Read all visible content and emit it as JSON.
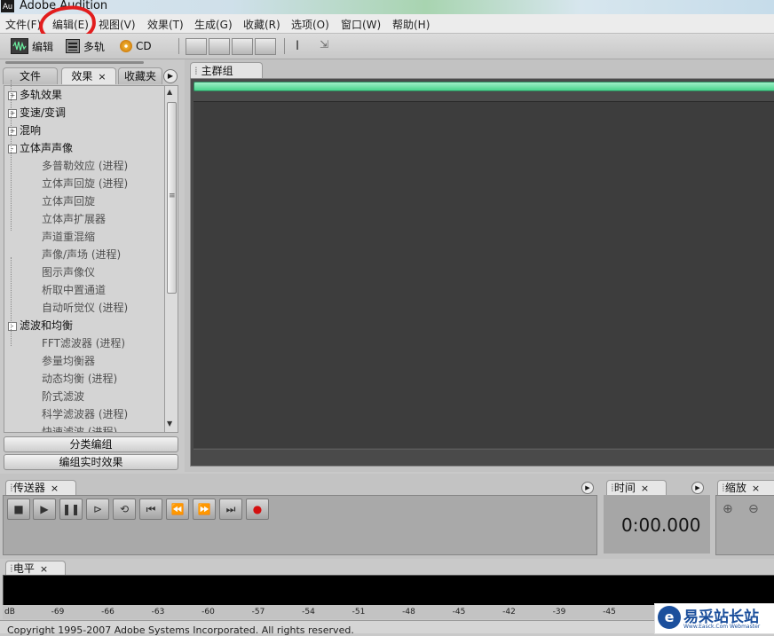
{
  "window": {
    "title": "Adobe Audition",
    "icon_label": "Au"
  },
  "menu": [
    "文件(F)",
    "编辑(E)",
    "视图(V)",
    "效果(T)",
    "生成(G)",
    "收藏(R)",
    "选项(O)",
    "窗口(W)",
    "帮助(H)"
  ],
  "toolbar": {
    "edit_label": "编辑",
    "multitrack_label": "多轨",
    "cd_label": "CD"
  },
  "left_panel": {
    "tabs": [
      "文件",
      "效果",
      "收藏夹"
    ],
    "tree": [
      {
        "label": "多轨效果",
        "level": 0,
        "expander": "+"
      },
      {
        "label": "变速/变调",
        "level": 0,
        "expander": "+"
      },
      {
        "label": "混响",
        "level": 0,
        "expander": "+"
      },
      {
        "label": "立体声声像",
        "level": 0,
        "expander": "-"
      },
      {
        "label": "多普勒效应 (进程)",
        "level": 1
      },
      {
        "label": "立体声回旋 (进程)",
        "level": 1
      },
      {
        "label": "立体声回旋",
        "level": 1
      },
      {
        "label": "立体声扩展器",
        "level": 1
      },
      {
        "label": "声道重混缩",
        "level": 1
      },
      {
        "label": "声像/声场 (进程)",
        "level": 1
      },
      {
        "label": "图示声像仪",
        "level": 1
      },
      {
        "label": "析取中置通道",
        "level": 1
      },
      {
        "label": "自动听觉仪 (进程)",
        "level": 1
      },
      {
        "label": "滤波和均衡",
        "level": 0,
        "expander": "-"
      },
      {
        "label": "FFT滤波器 (进程)",
        "level": 1
      },
      {
        "label": "参量均衡器",
        "level": 1
      },
      {
        "label": "动态均衡 (进程)",
        "level": 1
      },
      {
        "label": "阶式滤波",
        "level": 1
      },
      {
        "label": "科学滤波器 (进程)",
        "level": 1
      },
      {
        "label": "快速滤波 (进程)",
        "level": 1
      }
    ],
    "group_button": "分类编组",
    "realtime_button": "编组实时效果"
  },
  "main_panel": {
    "tab": "主群组"
  },
  "transport": {
    "tab": "传送器"
  },
  "time_panel": {
    "tab": "时间",
    "value": "0:00.000"
  },
  "zoom_panel": {
    "tab": "缩放"
  },
  "level_panel": {
    "tab": "电平",
    "scale": [
      "dB",
      "-69",
      "-66",
      "-63",
      "-60",
      "-57",
      "-54",
      "-51",
      "-48",
      "-45",
      "-42",
      "-39",
      "-45"
    ]
  },
  "status": {
    "text": "Copyright 1995-2007 Adobe Systems Incorporated. All rights reserved."
  },
  "watermark": {
    "logo": "e",
    "text": "易采站长站",
    "sub": "Www.Easck.Com Webmaster"
  },
  "colors": {
    "progress_green": "#49d48c",
    "annotation_red": "#e21d1d",
    "record_red": "#d41010"
  }
}
